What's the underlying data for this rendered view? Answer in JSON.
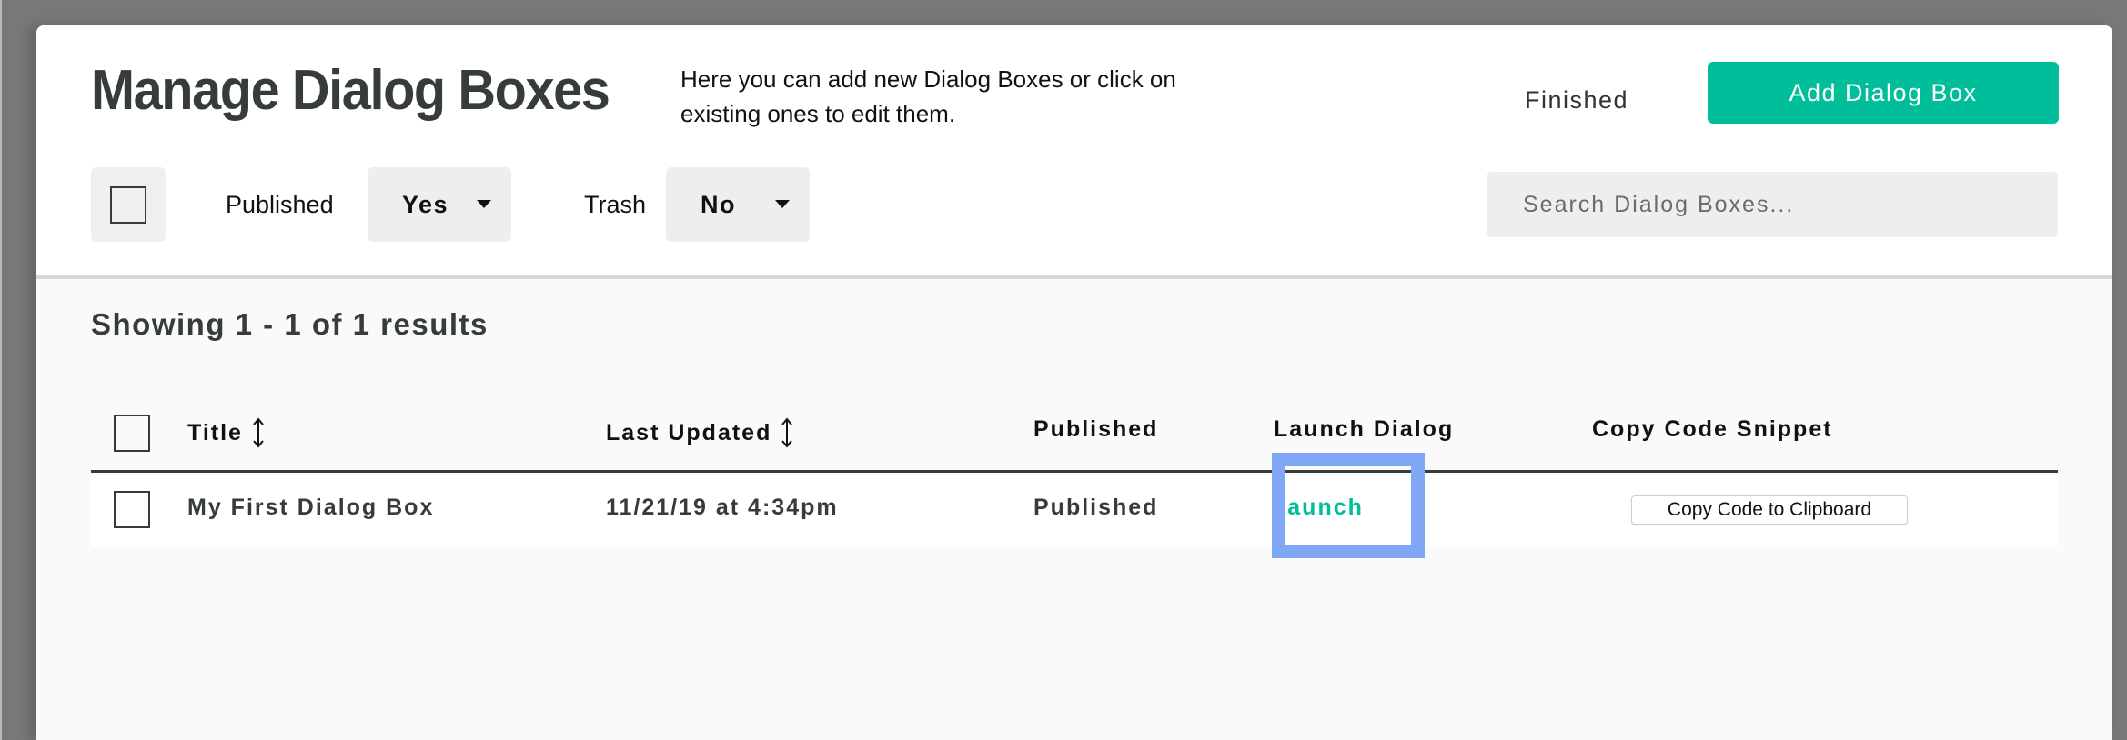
{
  "header": {
    "title": "Manage Dialog Boxes",
    "description": "Here you can add new Dialog Boxes or click on existing ones to edit them.",
    "finished_label": "Finished",
    "add_label": "Add Dialog Box"
  },
  "filters": {
    "published_label": "Published",
    "published_value": "Yes",
    "trash_label": "Trash",
    "trash_value": "No",
    "search_placeholder": "Search Dialog Boxes...",
    "search_value": ""
  },
  "results": {
    "summary": "Showing 1 - 1 of 1 results"
  },
  "table": {
    "columns": [
      "Title",
      "Last Updated",
      "Published",
      "Launch Dialog",
      "Copy Code Snippet"
    ],
    "sortable_icon": "sort-vertical-arrows-icon",
    "rows": [
      {
        "title": "My First Dialog Box",
        "last_updated": "11/21/19 at 4:34pm",
        "published": "Published",
        "launch_label": "Launch",
        "copy_label": "Copy Code to Clipboard"
      }
    ]
  },
  "colors": {
    "accent": "#00be9a",
    "highlight": "#7fa7f5",
    "title_text": "#363b3c",
    "overlay": "#787878"
  }
}
